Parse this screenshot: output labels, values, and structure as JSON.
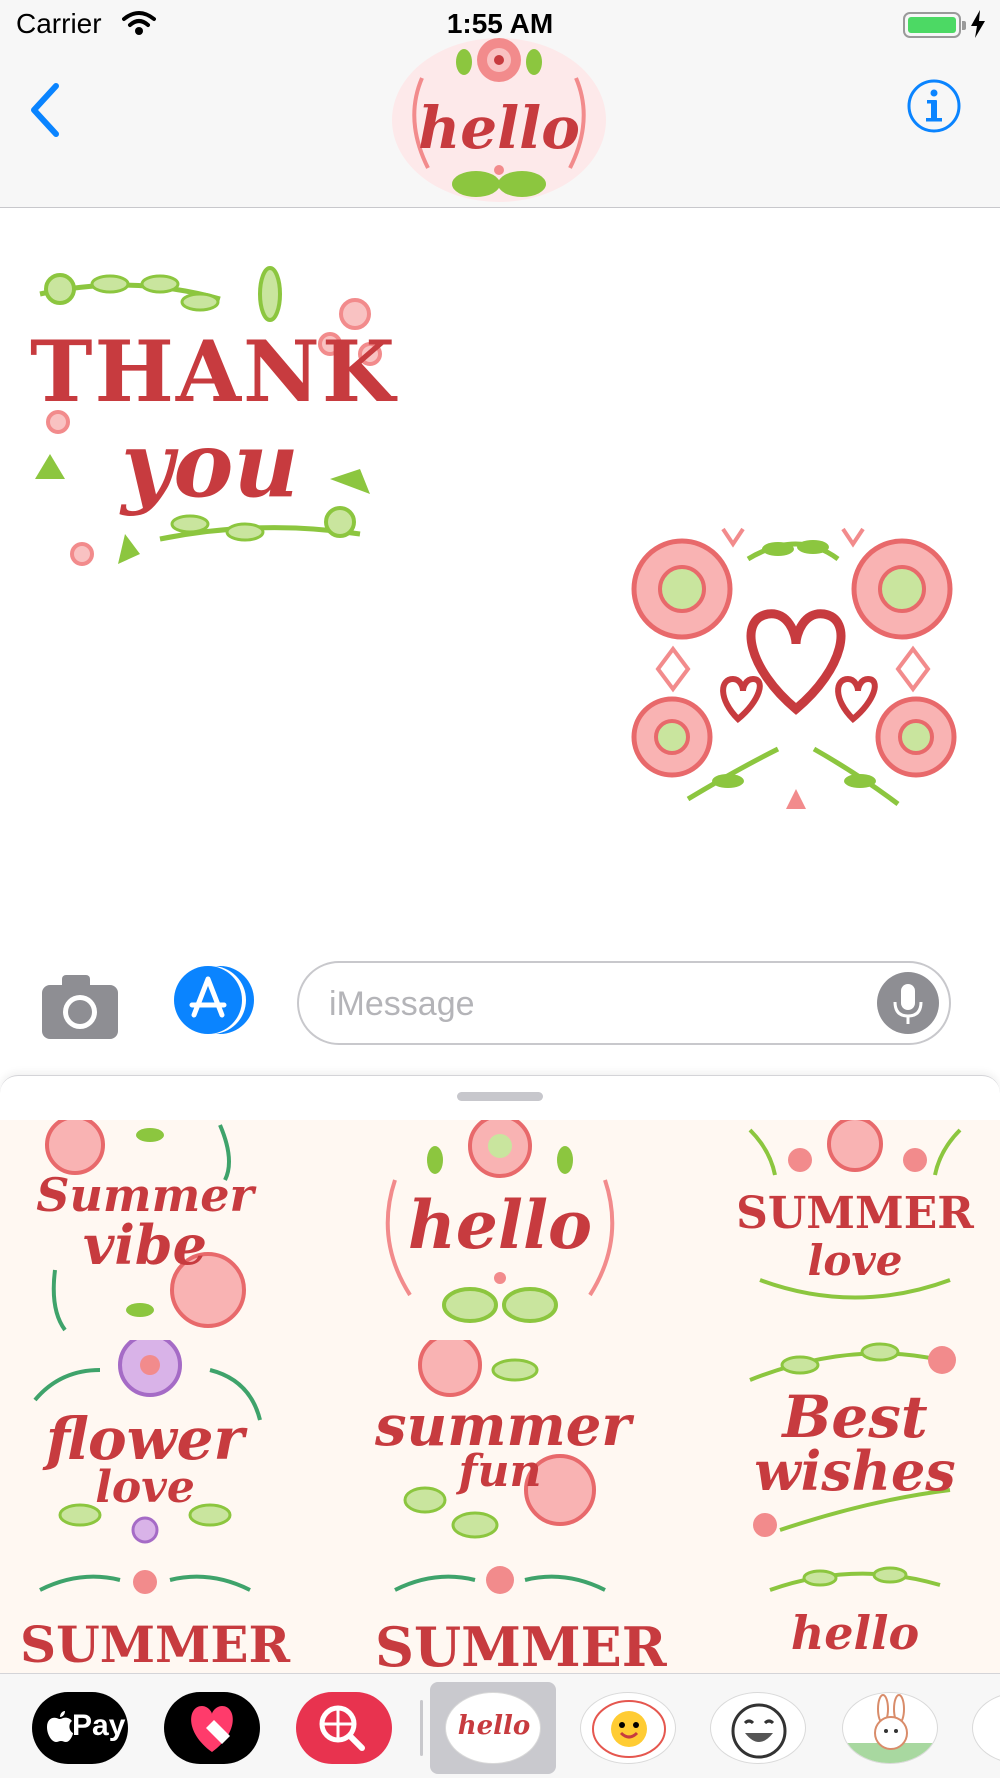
{
  "status_bar": {
    "carrier": "Carrier",
    "time": "1:55 AM",
    "battery_level": 1.0,
    "charging": true
  },
  "nav": {
    "contact_sticker_text": "hello"
  },
  "conversation": {
    "stickers": [
      {
        "side": "left",
        "line1": "THANK",
        "line2": "you"
      },
      {
        "side": "right"
      }
    ]
  },
  "input": {
    "placeholder": "iMessage",
    "value": ""
  },
  "drawer": {
    "stickers": [
      {
        "lines": [
          "Summer",
          "vibe"
        ]
      },
      {
        "lines": [
          "hello"
        ]
      },
      {
        "lines": [
          "SUMMER",
          "love"
        ]
      },
      {
        "lines": [
          "flower",
          "love"
        ]
      },
      {
        "lines": [
          "summer",
          "fun"
        ]
      },
      {
        "lines": [
          "Best",
          "wishes"
        ]
      },
      {
        "lines": [
          "SUMMER"
        ]
      },
      {
        "lines": [
          "SUMMER"
        ]
      },
      {
        "lines": [
          "hello"
        ]
      }
    ]
  },
  "app_tray": {
    "apps": [
      {
        "name": "Apple Pay",
        "label": "Pay"
      },
      {
        "name": "Digital Touch"
      },
      {
        "name": "Web Search"
      },
      {
        "name": "Hello sticker pack",
        "label": "hello",
        "selected": true
      },
      {
        "name": "Emoji sticker pack"
      },
      {
        "name": "Laughing sticker pack"
      },
      {
        "name": "Bunny sticker pack"
      }
    ]
  },
  "colors": {
    "accent": "#0a84ff",
    "sticker_red": "#c73b3f",
    "leaf_green": "#8cc63f",
    "rose_pink": "#f28b8c",
    "battery_green": "#4cd964",
    "web_search_pink": "#e8334f"
  }
}
